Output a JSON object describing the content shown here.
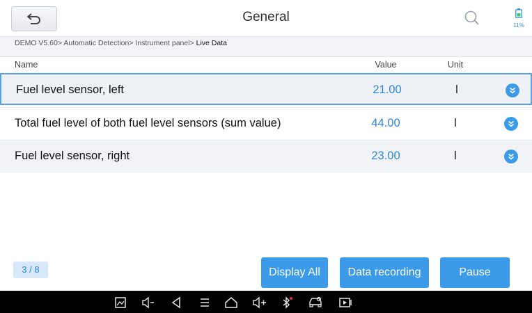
{
  "header": {
    "title": "General",
    "battery_percent": "11%"
  },
  "breadcrumb": {
    "path": "DEMO V5.60> Automatic Detection> Instrument panel> ",
    "current": "Live Data"
  },
  "table": {
    "columns": {
      "name": "Name",
      "value": "Value",
      "unit": "Unit"
    },
    "rows": [
      {
        "name": "Fuel level sensor, left",
        "value": "21.00",
        "unit": "l"
      },
      {
        "name": "Total fuel level of both fuel level sensors (sum value)",
        "value": "44.00",
        "unit": "l"
      },
      {
        "name": "Fuel level sensor, right",
        "value": "23.00",
        "unit": "l"
      }
    ]
  },
  "footer": {
    "page_indicator": "3 / 8",
    "display_all_label": "Display All",
    "data_recording_label": "Data recording",
    "pause_label": "Pause"
  },
  "colors": {
    "accent": "#3b9be8",
    "value_text": "#2f86d7",
    "selected_border": "#5aa0e3"
  },
  "icons": {
    "back": "back-arrow-icon",
    "search": "search-icon",
    "battery": "battery-icon",
    "expand": "chevron-down-icon",
    "nav": [
      "screenshot-icon",
      "volume-down-icon",
      "back-triangle-icon",
      "menu-icon",
      "home-icon",
      "volume-up-icon",
      "bluetooth-icon",
      "car-diagnostic-icon",
      "screen-record-icon"
    ]
  }
}
